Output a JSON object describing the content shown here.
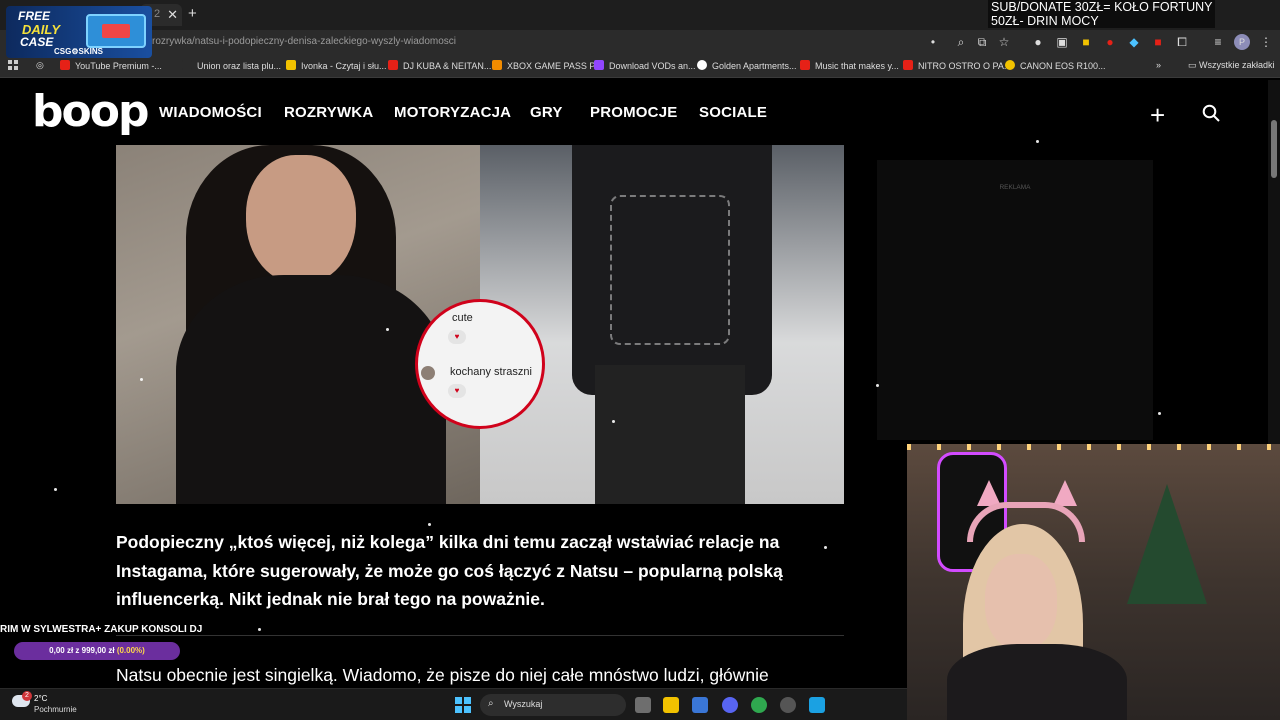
{
  "browser": {
    "tab_number": "2",
    "url": "rozrywka/natsu-i-podopieczny-denisa-zaleckiego-wyszly-wiadomosci",
    "bookmarks": [
      {
        "label": "YouTube Premium -...",
        "color": "#e62117"
      },
      {
        "label": "Union oraz lista plu...",
        "color": "#2b2b2b"
      },
      {
        "label": "Ivonka - Czytaj i słu...",
        "color": "#f2c200"
      },
      {
        "label": "DJ KUBA & NEITAN...",
        "color": "#e62117"
      },
      {
        "label": "XBOX GAME PASS P...",
        "color": "#f28c00"
      },
      {
        "label": "Download VODs an...",
        "color": "#9146ff"
      },
      {
        "label": "Golden Apartments...",
        "color": "#ffffff"
      },
      {
        "label": "Music that makes y...",
        "color": "#e62117"
      },
      {
        "label": "NITRO OSTRO O PA...",
        "color": "#e62117"
      },
      {
        "label": "CANON EOS R100...",
        "color": "#f2c200"
      }
    ],
    "all_bookmarks_label": "Wszystkie zakładki"
  },
  "site": {
    "logo": "boop",
    "nav": [
      "WIADOMOŚCI",
      "ROZRYWKA",
      "MOTORYZACJA",
      "GRY",
      "PROMOCJE",
      "SOCIALE"
    ]
  },
  "hero": {
    "chat_messages": [
      "cute",
      "kochany straszni"
    ]
  },
  "article": {
    "lead": "Podopieczny „ktoś więcej, niż kolega” kilka dni temu zaczął wstawiać relacje na Instagama, które sugerowały, że może go coś łączyć z Natsu – popularną polską influencerką. Nikt jednak nie brał tego na poważnie.",
    "para2": "Natsu obecnie jest singielką. Wiadomo, że pisze do niej całe mnóstwo ludzi, głównie"
  },
  "ad": {
    "label": "REKLAMA"
  },
  "overlay": {
    "promo": {
      "line1": "FREE",
      "line2": "DAILY",
      "line3": "CASE",
      "brand": "CSG⚙SKINS"
    },
    "donate_line1": "SUB/DONATE 30ZŁ= KOŁO FORTUNY",
    "donate_line2": "50ZŁ- DRIN MOCY",
    "goal_title": "RIM W SYLWESTRA+ ZAKUP KONSOLI DJ",
    "goal_current": "0,00 zł",
    "goal_separator": "z",
    "goal_target": "999,00 zł",
    "goal_percent": "(0.00%)",
    "goal_progress": 0.0
  },
  "taskbar": {
    "weather_badge": "2",
    "weather_temp": "2°C",
    "weather_desc": "Pochmurnie",
    "search_label": "Wyszukaj"
  },
  "colors": {
    "accent_red": "#d0021b",
    "goal_bar": "#6b2e9e",
    "windows_blue": "#4cc2ff"
  }
}
